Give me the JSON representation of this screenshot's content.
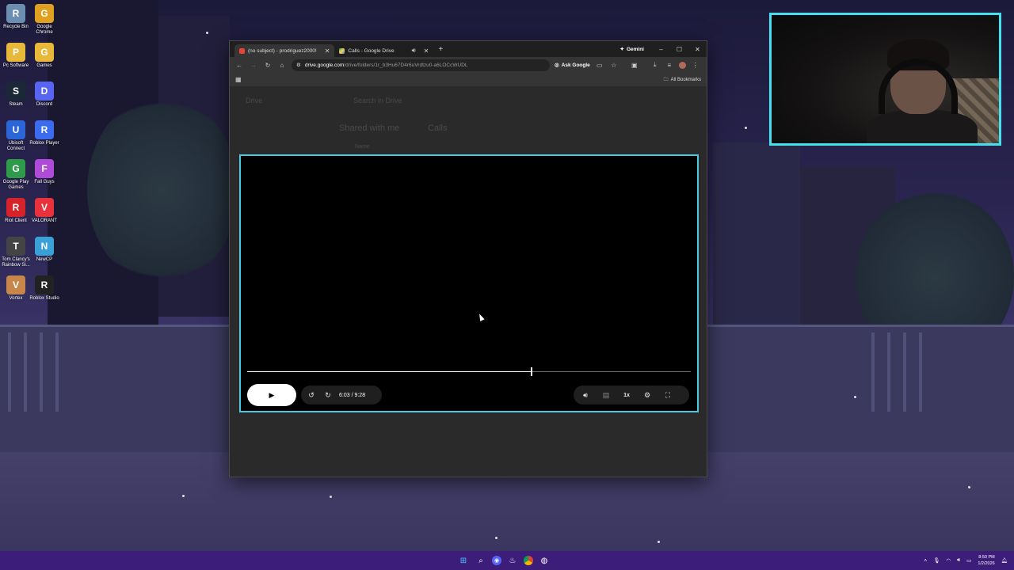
{
  "desktop": {
    "icons": [
      {
        "label": "Recycle Bin",
        "icon": "recycle-bin-icon",
        "color": "#6a8fb0"
      },
      {
        "label": "Google Chrome",
        "icon": "chrome-icon",
        "color": "#e0a020"
      },
      {
        "label": "Pc Software",
        "icon": "folder-icon",
        "color": "#e8b83a"
      },
      {
        "label": "Games",
        "icon": "folder-icon",
        "color": "#e8b83a"
      },
      {
        "label": "Steam",
        "icon": "steam-icon",
        "color": "#1b2838"
      },
      {
        "label": "Discord",
        "icon": "discord-icon",
        "color": "#5865f2"
      },
      {
        "label": "Ubisoft Connect",
        "icon": "ubisoft-icon",
        "color": "#2a66d8"
      },
      {
        "label": "Roblox Player",
        "icon": "roblox-player-icon",
        "color": "#3b6cf0"
      },
      {
        "label": "Google Play Games",
        "icon": "google-play-games-icon",
        "color": "#2e9b4a"
      },
      {
        "label": "Fall Guys",
        "icon": "fall-guys-icon",
        "color": "#b04ad8"
      },
      {
        "label": "Riot Client",
        "icon": "riot-client-icon",
        "color": "#d6232a"
      },
      {
        "label": "VALORANT",
        "icon": "valorant-icon",
        "color": "#e8313c"
      },
      {
        "label": "Tom Clancy's Rainbow Si...",
        "icon": "rainbow-six-icon",
        "color": "#444"
      },
      {
        "label": "NewCP",
        "icon": "newcp-icon",
        "color": "#3aa0d8"
      },
      {
        "label": "Vortex",
        "icon": "vortex-icon",
        "color": "#c8874a"
      },
      {
        "label": "Roblox Studio",
        "icon": "roblox-studio-icon",
        "color": "#222"
      }
    ]
  },
  "browser": {
    "tabs": [
      {
        "label": "(no subject) - prodriguez2000!",
        "favicon": "gmail-icon",
        "active": true
      },
      {
        "label": "Calls - Google Drive",
        "favicon": "google-drive-icon",
        "active": false
      }
    ],
    "gemini_label": "Gemini",
    "window_controls": {
      "minimize": "–",
      "maximize": "☐",
      "close": "✕"
    },
    "url_host": "drive.google.com",
    "url_path": "/drive/folders/1r_b3Hu67D4r6uVrdtzu0-a6LOCcWUDL",
    "ask_google_label": "Ask Google",
    "all_bookmarks_label": "All Bookmarks"
  },
  "drive_ghost": {
    "brand": "Drive",
    "search_placeholder": "Search in Drive",
    "breadcrumb_shared": "Shared with me",
    "breadcrumb_folder": "Calls",
    "name_header": "Name"
  },
  "player": {
    "current_time": "6:03",
    "duration": "9:28",
    "time_display": "6:03 / 9:28",
    "progress_fraction": 0.639,
    "speed_label": "1x",
    "accent_color": "#4fc7e0"
  },
  "taskbar": {
    "apps": [
      "windows-start-icon",
      "search-icon",
      "discord-icon",
      "steam-icon",
      "chrome-icon",
      "obs-icon"
    ],
    "time": "8:50 PM",
    "date": "1/2/2026"
  }
}
